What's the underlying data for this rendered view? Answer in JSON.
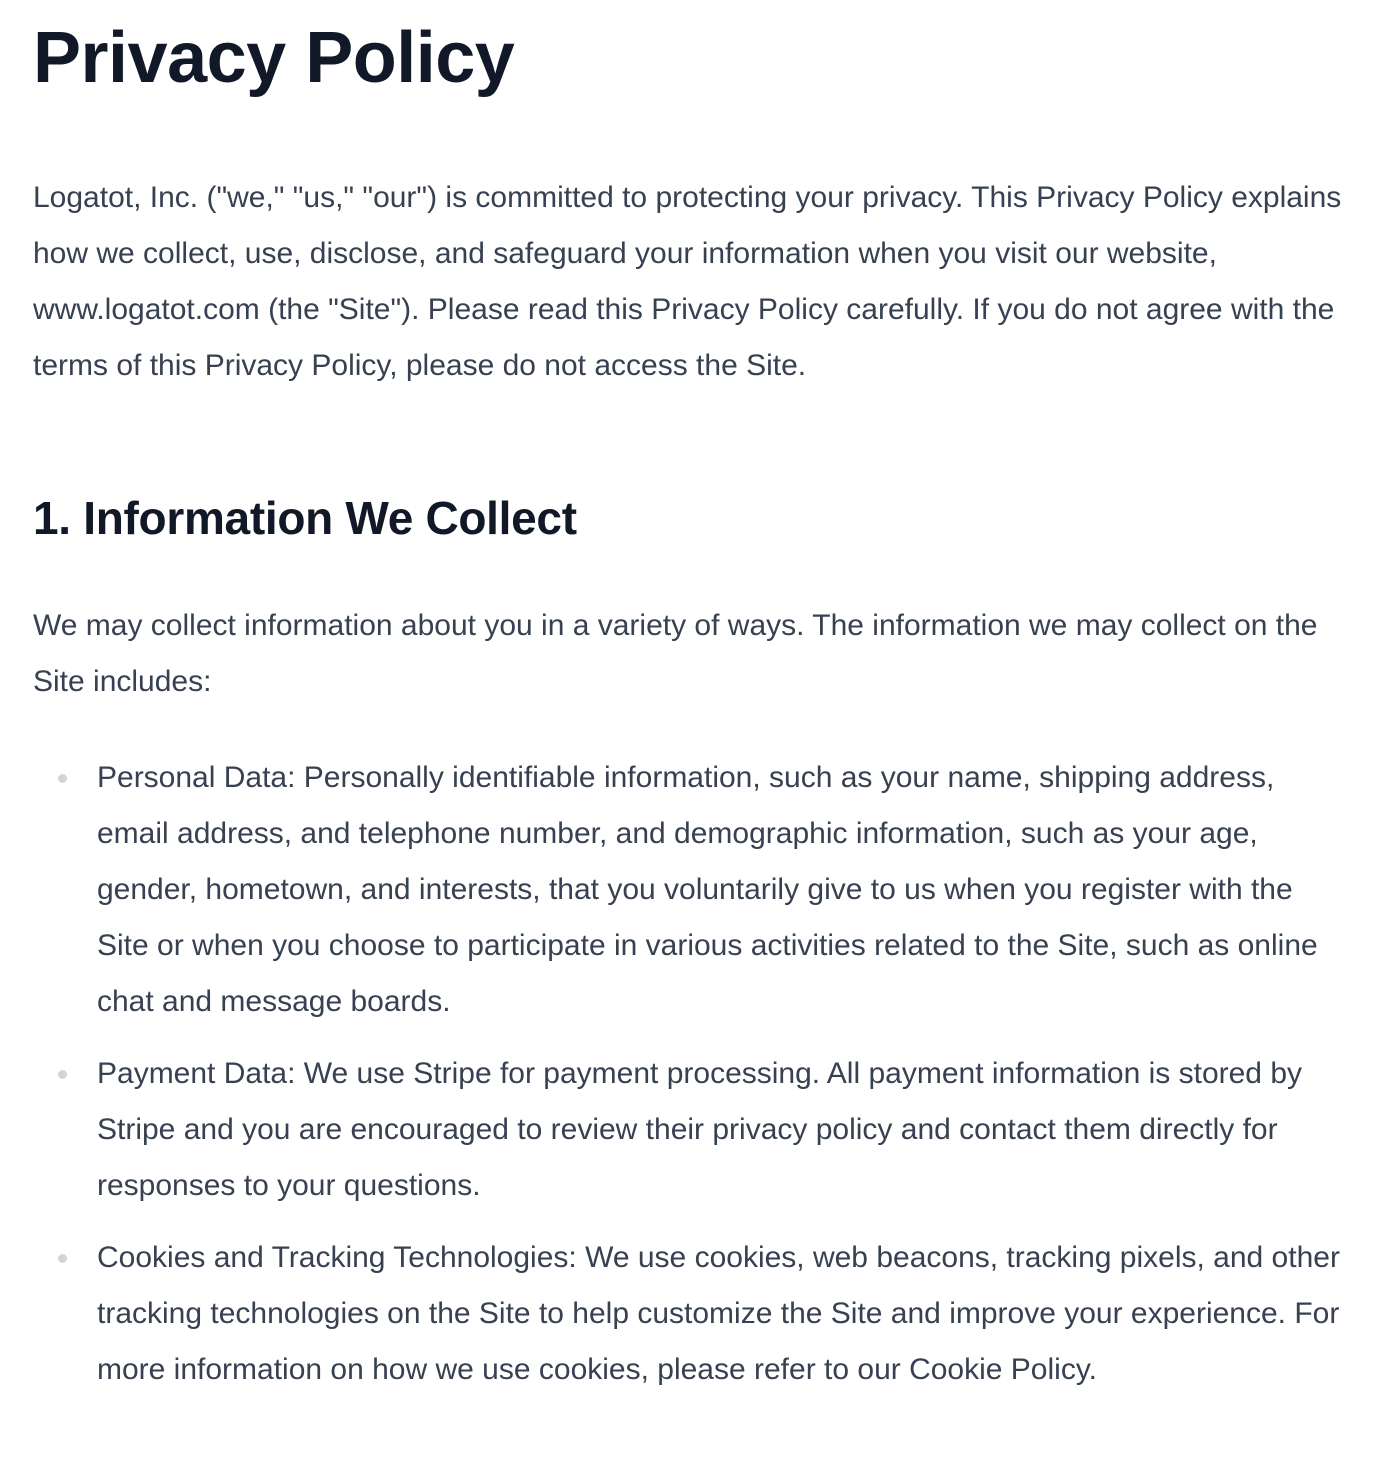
{
  "title": "Privacy Policy",
  "intro": "Logatot, Inc. (\"we,\" \"us,\" \"our\") is committed to protecting your privacy. This Privacy Policy explains how we collect, use, disclose, and safeguard your information when you visit our website, www.logatot.com (the \"Site\"). Please read this Privacy Policy carefully. If you do not agree with the terms of this Privacy Policy, please do not access the Site.",
  "section1": {
    "heading": "1. Information We Collect",
    "intro": "We may collect information about you in a variety of ways. The information we may collect on the Site includes:",
    "items": [
      "Personal Data: Personally identifiable information, such as your name, shipping address, email address, and telephone number, and demographic information, such as your age, gender, hometown, and interests, that you voluntarily give to us when you register with the Site or when you choose to participate in various activities related to the Site, such as online chat and message boards.",
      "Payment Data: We use Stripe for payment processing. All payment information is stored by Stripe and you are encouraged to review their privacy policy and contact them directly for responses to your questions.",
      "Cookies and Tracking Technologies: We use cookies, web beacons, tracking pixels, and other tracking technologies on the Site to help customize the Site and improve your experience. For more information on how we use cookies, please refer to our Cookie Policy."
    ]
  }
}
